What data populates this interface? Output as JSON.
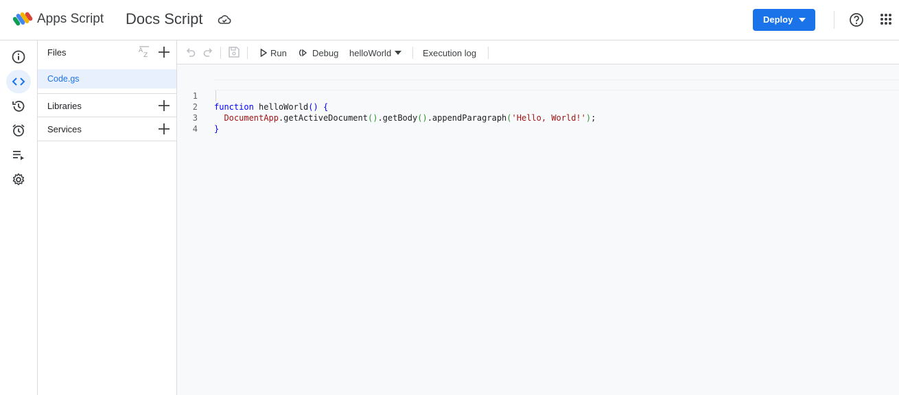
{
  "header": {
    "app_name": "Apps Script",
    "project_title": "Docs Script",
    "deploy_label": "Deploy"
  },
  "rail": {
    "items": [
      {
        "icon": "info-icon",
        "label": "Overview"
      },
      {
        "icon": "code-icon",
        "label": "Editor",
        "active": true
      },
      {
        "icon": "history-icon",
        "label": "Project History"
      },
      {
        "icon": "alarm-icon",
        "label": "Triggers"
      },
      {
        "icon": "executions-icon",
        "label": "Executions"
      },
      {
        "icon": "gear-icon",
        "label": "Project Settings"
      }
    ]
  },
  "files_panel": {
    "files_label": "Files",
    "file_name": "Code.gs",
    "libraries_label": "Libraries",
    "services_label": "Services"
  },
  "toolbar": {
    "run_label": "Run",
    "debug_label": "Debug",
    "function_select": "helloWorld",
    "execution_log_label": "Execution log"
  },
  "editor": {
    "line_numbers": [
      "1",
      "2",
      "3",
      "4"
    ],
    "tokens": {
      "l1_kw": "function",
      "l1_name": " helloWorld",
      "l1_parens": "()",
      "l1_brace": " {",
      "l2_indent": "  ",
      "l2_cls": "DocumentApp",
      "l2_m1": ".getActiveDocument",
      "l2_p1": "()",
      "l2_m2": ".getBody",
      "l2_p2": "()",
      "l2_m3": ".appendParagraph",
      "l2_open": "(",
      "l2_str": "'Hello, World!'",
      "l2_close": ")",
      "l2_end": ";",
      "l3_brace": "}"
    }
  },
  "colors": {
    "accent": "#1a73e8",
    "active_bg": "#e8f0fe",
    "keyword": "#0000ff",
    "string": "#a31515"
  }
}
